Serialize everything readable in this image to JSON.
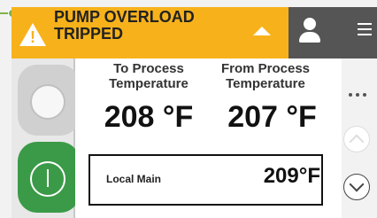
{
  "alarm": {
    "text": "PUMP OVERLOAD TRIPPED",
    "icon": "warning-triangle-icon",
    "color": "#f7b21b"
  },
  "header_buttons": {
    "user_icon": "user-icon",
    "menu_icon": "hamburger-menu-icon",
    "button_color": "#555555"
  },
  "controls": {
    "grey_button_icon": "circle-off-icon",
    "green_button_icon": "power-on-icon",
    "green_color": "#3b9a47"
  },
  "temperatures": {
    "to_label": "To Process Temperature",
    "to_value": "208 °F",
    "from_label": "From Process Temperature",
    "from_value": "207 °F"
  },
  "local": {
    "label": "Local Main",
    "value": "209°F"
  },
  "more_icon": "more-dots-icon",
  "scroll_icons": {
    "up": "chevron-up-icon",
    "down": "chevron-down-icon"
  }
}
